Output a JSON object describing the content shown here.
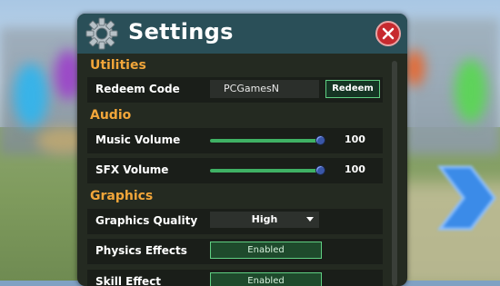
{
  "window": {
    "title": "Settings"
  },
  "colors": {
    "header": "#2a4f58",
    "section": "#f2a63a",
    "accent_green": "#3fb164",
    "close_red": "#c72a2f"
  },
  "icons": {
    "settings": "gear-icon",
    "close": "close-icon",
    "next": "chevron-right-icon",
    "dropdown": "chevron-down-icon"
  },
  "sections": {
    "utilities": {
      "title": "Utilities",
      "redeem": {
        "label": "Redeem Code",
        "input_value": "PCGamesN",
        "button": "Redeem"
      }
    },
    "audio": {
      "title": "Audio",
      "music": {
        "label": "Music Volume",
        "value": "100",
        "level_percent": 100
      },
      "sfx": {
        "label": "SFX Volume",
        "value": "100",
        "level_percent": 100
      }
    },
    "graphics": {
      "title": "Graphics",
      "quality": {
        "label": "Graphics Quality",
        "selected": "High"
      },
      "physics": {
        "label": "Physics Effects",
        "state": "Enabled"
      },
      "skill": {
        "label": "Skill Effect",
        "state": "Enabled"
      }
    }
  }
}
